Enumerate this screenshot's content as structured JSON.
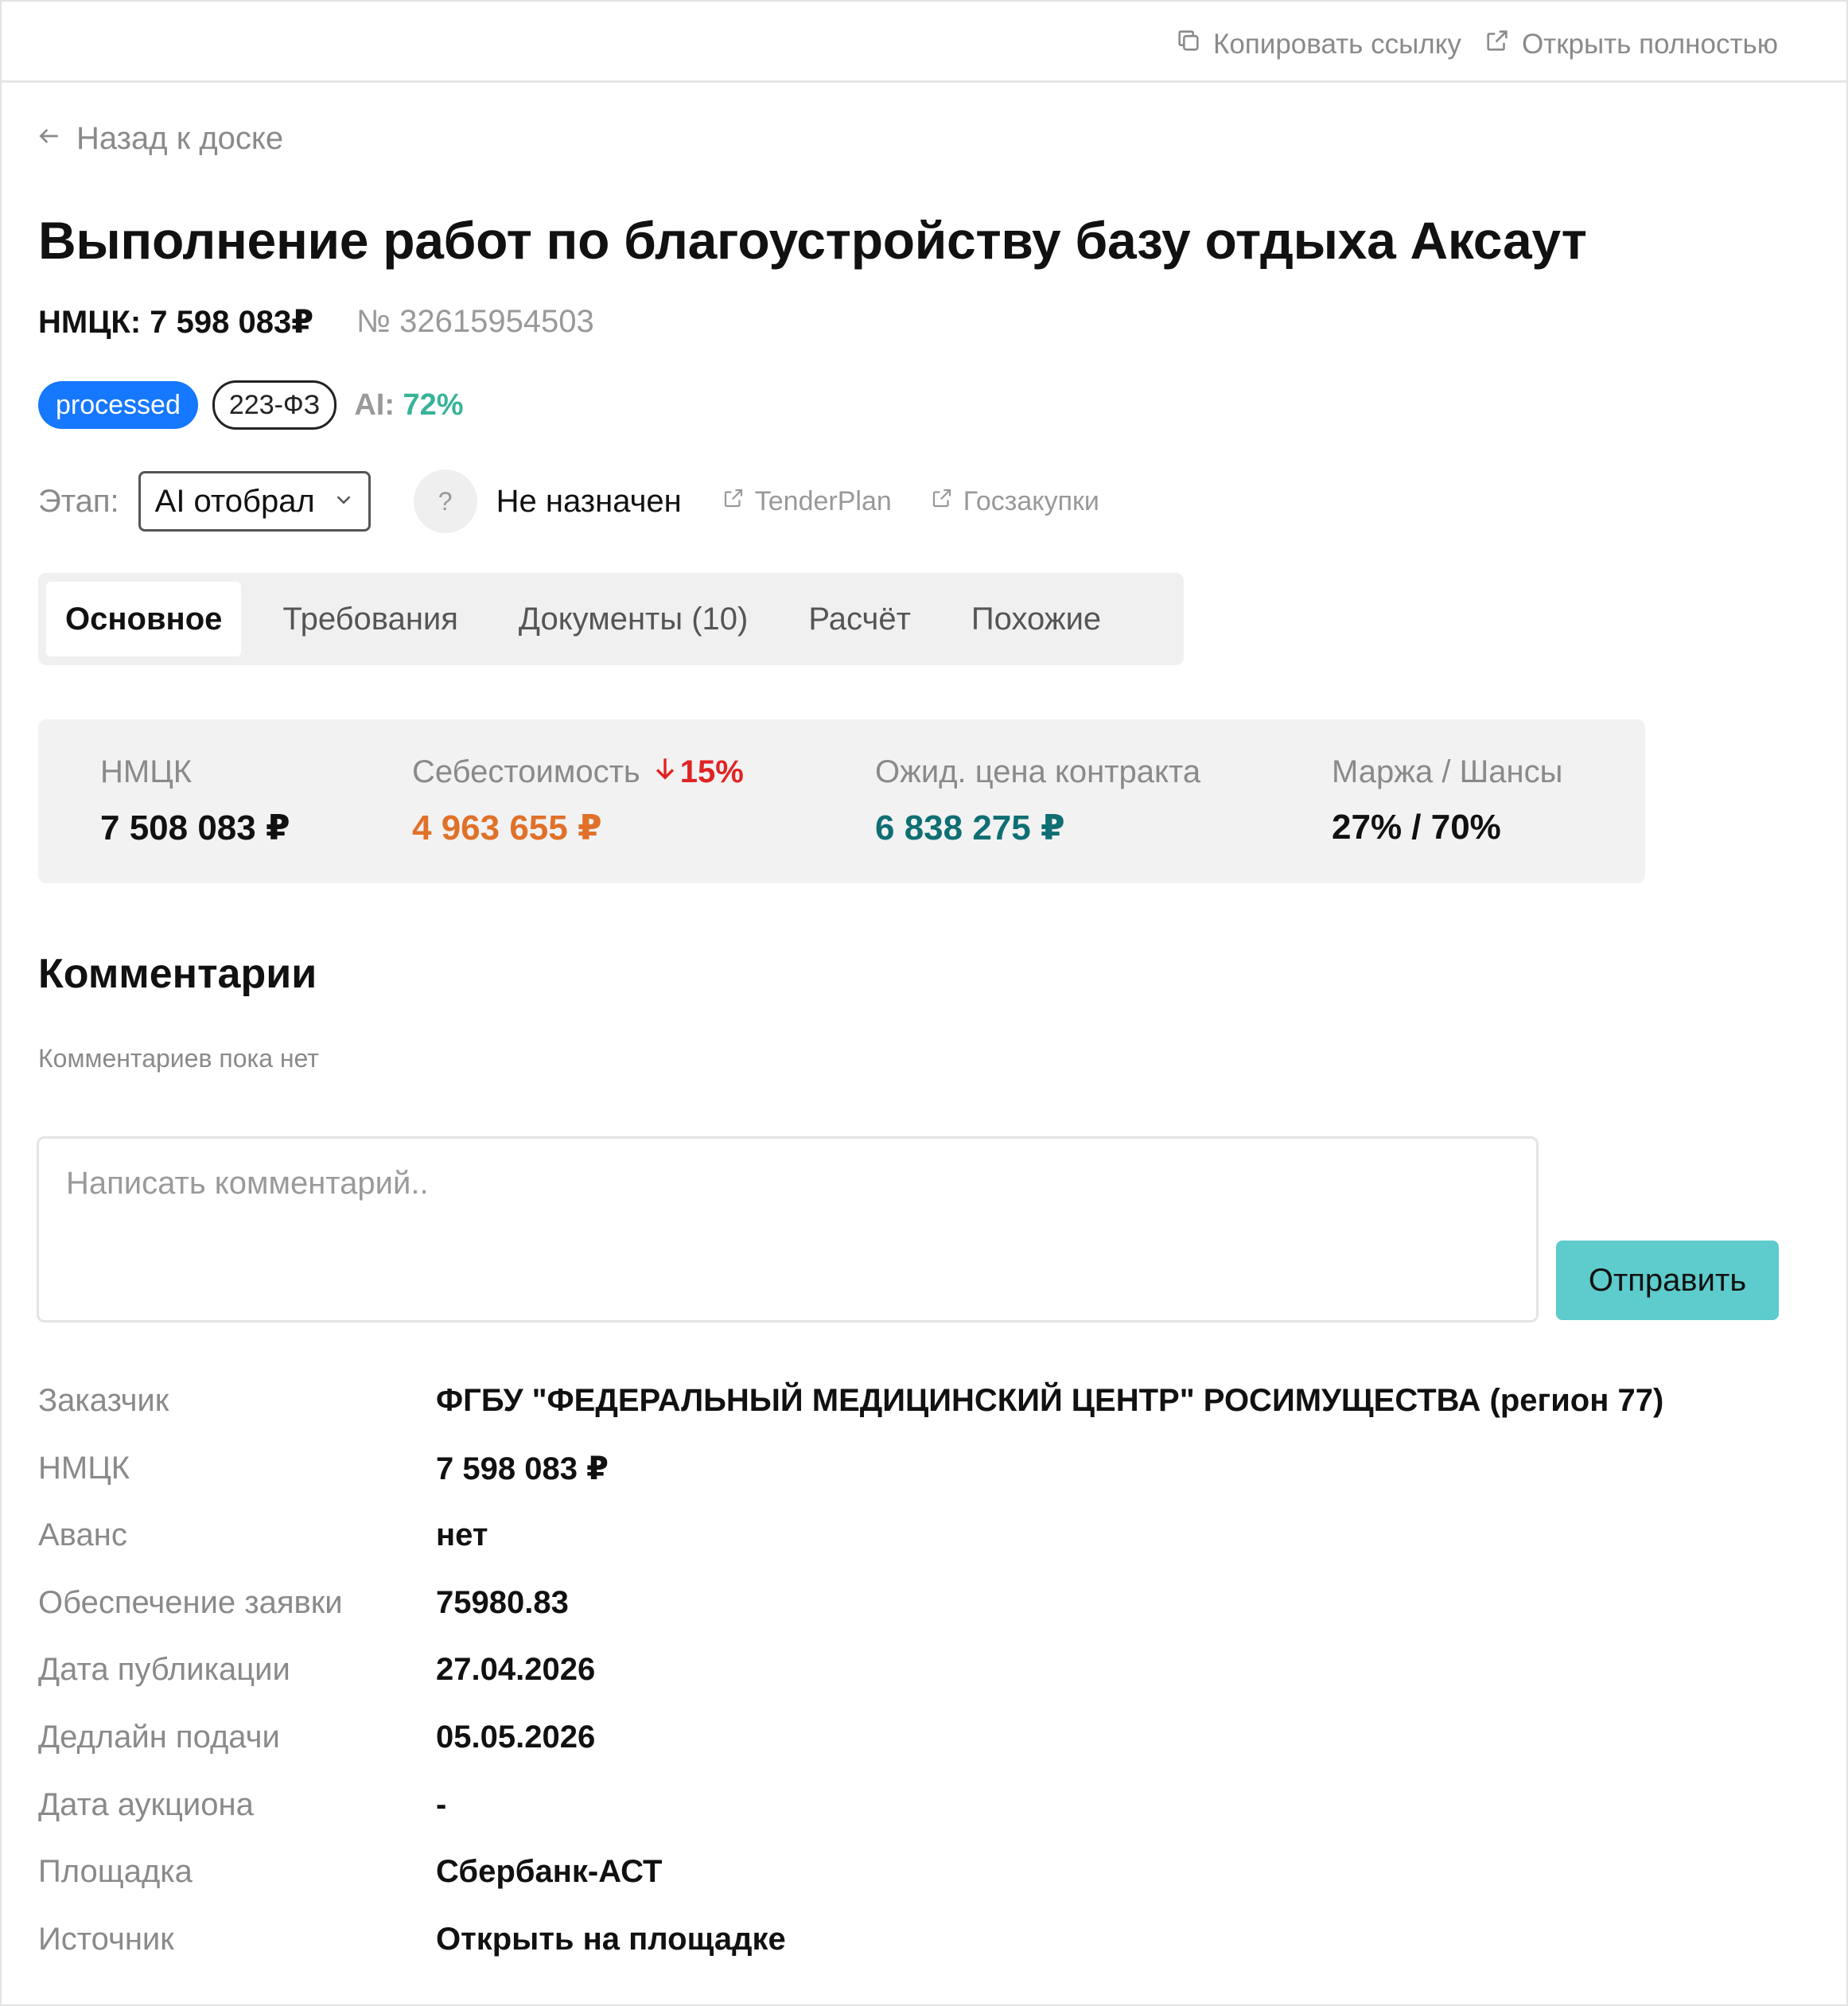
{
  "topbar": {
    "copy_link": "Копировать ссылку",
    "open_full": "Открыть полностью"
  },
  "back": {
    "label": "Назад к доске"
  },
  "title": "Выполнение работ по благоустройству базу отдыха Аксаут",
  "meta": {
    "nmck": "НМЦК: 7 598 083₽",
    "number": "№ 32615954503"
  },
  "badges": {
    "status": "processed",
    "law": "223-ФЗ",
    "ai_label": "AI:",
    "ai_value": "72%"
  },
  "stage": {
    "label": "Этап:",
    "value": "AI отобрал",
    "assignee_avatar": "?",
    "assignee": "Не назначен"
  },
  "links": {
    "tenderplan": "TenderPlan",
    "goszakupki": "Госзакупки"
  },
  "tabs": [
    "Основное",
    "Требования",
    "Документы (10)",
    "Расчёт",
    "Похожие"
  ],
  "stats": {
    "nmck": {
      "label": "НМЦК",
      "value": "7 508 083 ₽"
    },
    "cost": {
      "label": "Себестоимость",
      "delta": "15%",
      "value": "4 963 655 ₽"
    },
    "expected": {
      "label": "Ожид. цена контракта",
      "value": "6 838 275 ₽"
    },
    "margin": {
      "label": "Маржа / Шансы",
      "value": "27% / 70%"
    }
  },
  "comments": {
    "heading": "Комментарии",
    "empty": "Комментариев пока нет",
    "placeholder": "Написать комментарий..",
    "send": "Отправить"
  },
  "details": [
    {
      "key": "Заказчик",
      "value": "ФГБУ \"ФЕДЕРАЛЬНЫЙ МЕДИЦИНСКИЙ ЦЕНТР\" РОСИМУЩЕСТВА (регион 77)"
    },
    {
      "key": "НМЦК",
      "value": "7 598 083 ₽"
    },
    {
      "key": "Аванс",
      "value": "нет"
    },
    {
      "key": "Обеспечение заявки",
      "value": "75980.83"
    },
    {
      "key": "Дата публикации",
      "value": "27.04.2026"
    },
    {
      "key": "Дедлайн подачи",
      "value": "05.05.2026"
    },
    {
      "key": "Дата аукциона",
      "value": "-"
    },
    {
      "key": "Площадка",
      "value": "Сбербанк-АСТ"
    },
    {
      "key": "Источник",
      "value": "Открыть на площадке"
    }
  ],
  "colors": {
    "accent_blue": "#1677ff",
    "ai_green": "#38b39a",
    "cost_orange": "#e0712a",
    "expected_teal": "#0f6f73",
    "delta_red": "#e02424",
    "send_button": "#5ecbcc"
  },
  "icons": {
    "copy": "copy-icon",
    "external": "external-link-icon",
    "back": "arrow-left-icon",
    "chevron": "chevron-down-icon",
    "down_arrow": "arrow-down-icon"
  }
}
